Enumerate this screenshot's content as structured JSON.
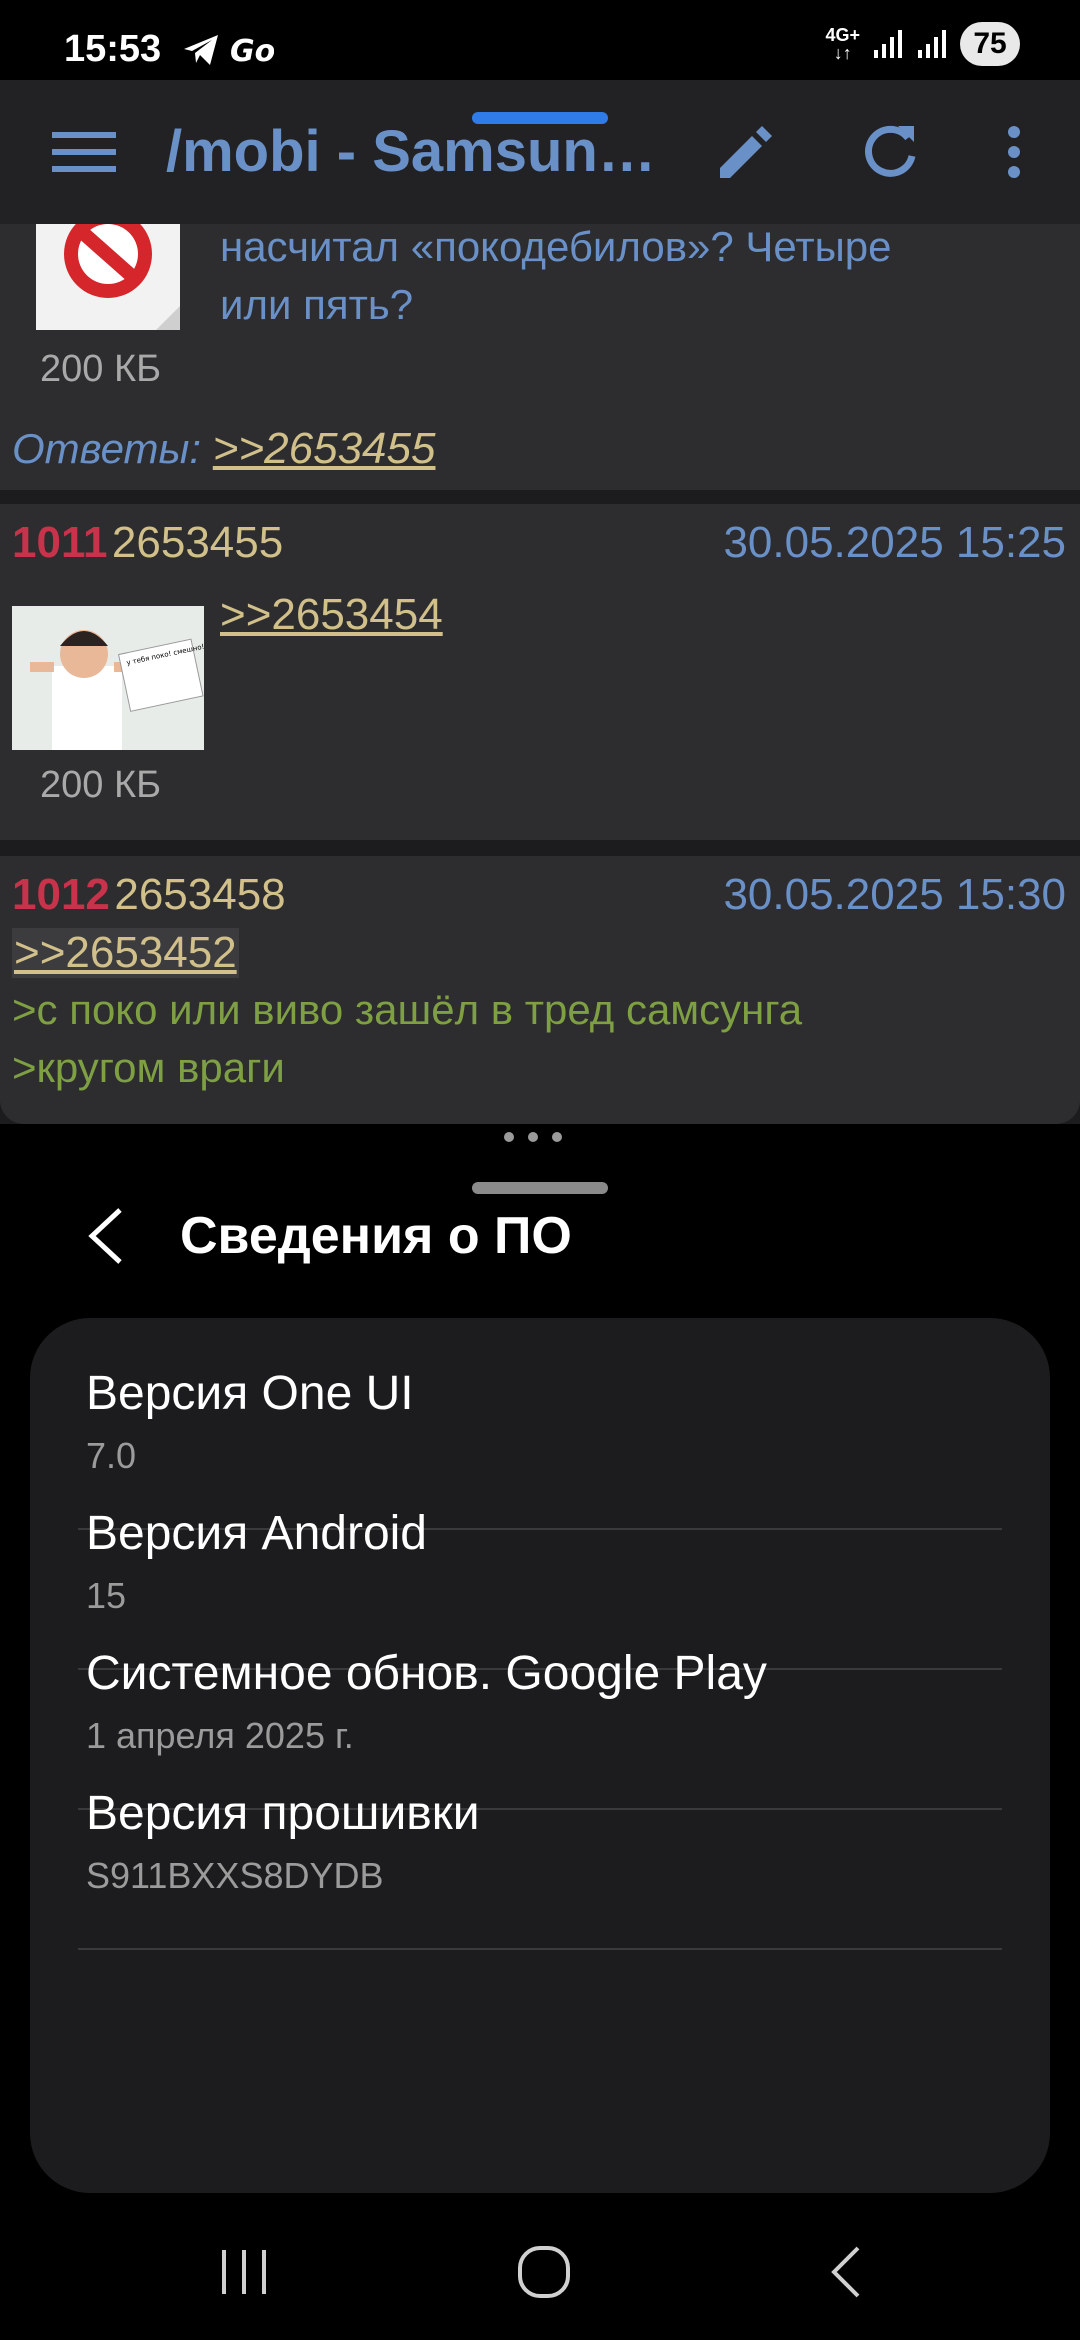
{
  "status_bar": {
    "time": "15:53",
    "network": "4G+",
    "battery": "75"
  },
  "toolbar": {
    "title": "/mobi - Samsun…",
    "icons": [
      "menu-icon",
      "edit-pencil-icon",
      "refresh-icon",
      "more-vert-icon"
    ],
    "accent": "#6a90c8"
  },
  "thread": {
    "partial_post": {
      "text_line1": "насчитал «покодебилов»? Четыре",
      "text_line2": "или пять?",
      "filesize": "200 КБ",
      "replies_label": "Ответы:",
      "reply_link": ">>2653455"
    },
    "posts": [
      {
        "number": "1011",
        "id": "2653455",
        "date": "30.05.2025 15:25",
        "reply_to": ">>2653454",
        "filesize": "200 КБ",
        "image_caption": "у тебя поко! смешно! а тебя ещё раз говорю, у тебя поко, а не самсунг"
      },
      {
        "number": "1012",
        "id": "2653458",
        "date": "30.05.2025 15:30",
        "reply_to": ">>2653452",
        "greentext": [
          ">с поко или виво зашёл в тред самсунга",
          ">кругом враги"
        ]
      }
    ]
  },
  "sheet": {
    "title": "Сведения о ПО",
    "items": [
      {
        "label": "Версия One UI",
        "value": "7.0"
      },
      {
        "label": "Версия Android",
        "value": "15"
      },
      {
        "label": "Системное обнов. Google Play",
        "value": "1 апреля 2025 г."
      },
      {
        "label": "Версия прошивки",
        "value": "S911BXXS8DYDB"
      }
    ]
  },
  "navbar": {
    "icons": [
      "recents-icon",
      "home-icon",
      "back-icon"
    ]
  }
}
